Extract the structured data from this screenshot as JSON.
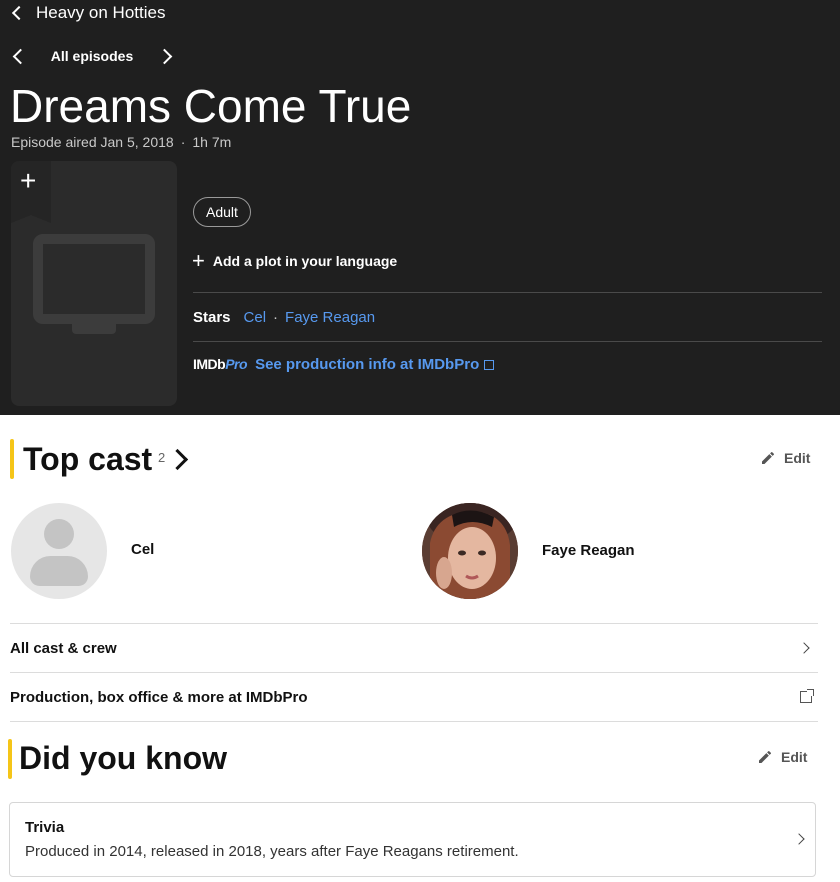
{
  "header": {
    "series_title": "Heavy on Hotties",
    "episode_nav_label": "All episodes",
    "episode_title": "Dreams Come True",
    "air_date": "Episode aired Jan 5, 2018",
    "runtime": "1h 7m",
    "genre_chip": "Adult",
    "add_plot": "Add a plot in your language",
    "stars_label": "Stars",
    "stars": [
      "Cel",
      "Faye Reagan"
    ],
    "imdbpro_logo_main": "IMDb",
    "imdbpro_logo_pro": "Pro",
    "imdbpro_link": "See production info at IMDbPro"
  },
  "top_cast": {
    "title": "Top cast",
    "count": "2",
    "edit_label": "Edit",
    "cast": [
      {
        "name": "Cel",
        "avatar": "person-placeholder-icon"
      },
      {
        "name": "Faye Reagan",
        "avatar": "photo"
      }
    ]
  },
  "links": {
    "all_cast_crew": "All cast & crew",
    "production_imdbpro": "Production, box office & more at IMDbPro"
  },
  "did_you_know": {
    "title": "Did you know",
    "edit_label": "Edit",
    "trivia_label": "Trivia",
    "trivia_text": "Produced in 2014, released in 2018, years after Faye Reagans retirement."
  },
  "colors": {
    "hero_bg": "#1f1f1f",
    "accent_yellow": "#f5c518",
    "link_blue": "#5799ef"
  }
}
